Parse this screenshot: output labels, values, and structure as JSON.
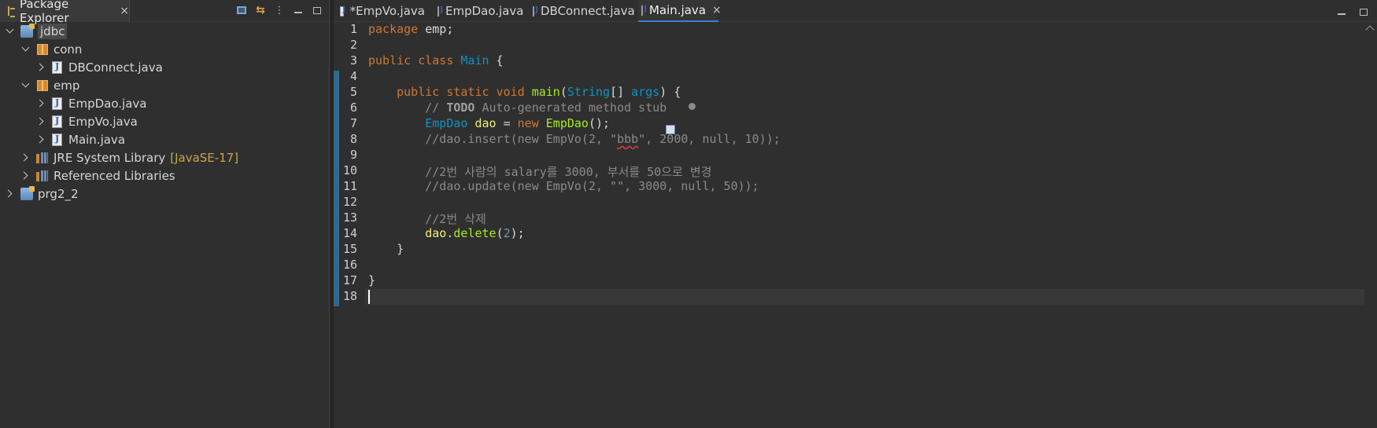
{
  "explorer": {
    "title": "Package Explorer",
    "close": "×",
    "tree": [
      {
        "label": "jdbc",
        "depth": 0,
        "expanded": true,
        "icon": "project",
        "selected": true
      },
      {
        "label": "conn",
        "depth": 1,
        "expanded": true,
        "icon": "package"
      },
      {
        "label": "DBConnect.java",
        "depth": 2,
        "expanded": false,
        "icon": "java-file"
      },
      {
        "label": "emp",
        "depth": 1,
        "expanded": true,
        "icon": "package"
      },
      {
        "label": "EmpDao.java",
        "depth": 2,
        "expanded": false,
        "icon": "java-file"
      },
      {
        "label": "EmpVo.java",
        "depth": 2,
        "expanded": false,
        "icon": "java-file"
      },
      {
        "label": "Main.java",
        "depth": 2,
        "expanded": false,
        "icon": "java-file"
      },
      {
        "label": "JRE System Library",
        "hint": "[JavaSE-17]",
        "depth": 1,
        "expanded": false,
        "icon": "library"
      },
      {
        "label": "Referenced Libraries",
        "depth": 1,
        "expanded": false,
        "icon": "library"
      },
      {
        "label": "prg2_2",
        "depth": 0,
        "expanded": false,
        "icon": "project"
      }
    ]
  },
  "editor": {
    "tabs": [
      {
        "label": "*EmpVo.java",
        "active": false
      },
      {
        "label": "EmpDao.java",
        "active": false
      },
      {
        "label": "DBConnect.java",
        "active": false
      },
      {
        "label": "Main.java",
        "active": true
      }
    ],
    "tab_close": "×",
    "line_numbers": [
      "1",
      "2",
      "3",
      "4",
      "5",
      "6",
      "7",
      "8",
      "9",
      "10",
      "11",
      "12",
      "13",
      "14",
      "15",
      "16",
      "17",
      "18"
    ],
    "current_line": 18
  },
  "code": {
    "l1": {
      "kw": "package",
      "rest": " emp;"
    },
    "l3": {
      "kw1": "public",
      "kw2": "class",
      "cls": "Main",
      "rest": " {"
    },
    "l5": {
      "kw1": "public",
      "kw2": "static",
      "kw3": "void",
      "mth": "main",
      "p1": "(",
      "cls": "String",
      "p2": "[] ",
      "var": "args",
      "p3": ") {"
    },
    "l6": {
      "c1": "// ",
      "todo": "TODO",
      "c2": " Auto-generated method stub"
    },
    "l7": {
      "cls1": "EmpDao",
      "var": "dao",
      "eq": " = ",
      "kw": "new",
      "mth": "EmpDao",
      "rest": "();"
    },
    "l8": {
      "c1": "//dao.insert(new EmpVo(2, \"",
      "squig": "bbb",
      "c2": "\", 2000, null, 10));"
    },
    "l10": "//2번 사람의 salary를 3000, 부서를 50으로 변경",
    "l11": "//dao.update(new EmpVo(2, \"\", 3000, null, 50));",
    "l13": "//2번 삭제",
    "l14": {
      "var": "dao",
      "dot": ".",
      "mth": "delete",
      "p1": "(",
      "num": "2",
      "p2": ");"
    },
    "l15": "}",
    "l17": "}"
  }
}
